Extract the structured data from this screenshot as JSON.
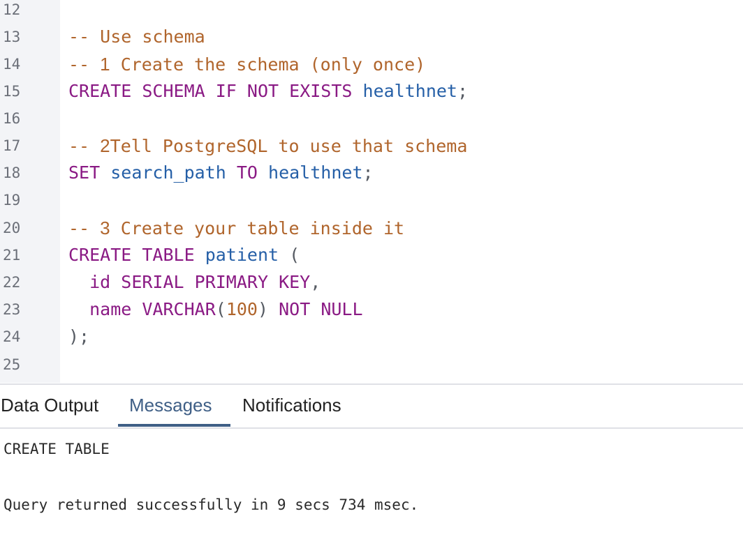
{
  "editor": {
    "line_numbers": [
      "12",
      "13",
      "14",
      "15",
      "16",
      "17",
      "18",
      "19",
      "20",
      "21",
      "22",
      "23",
      "24",
      "25"
    ],
    "lines": {
      "l13": {
        "comment": "-- Use schema"
      },
      "l14": {
        "dash": "--",
        "num": "1",
        "rest": "Create the schema (only once)"
      },
      "l15": {
        "kw1": "CREATE",
        "kw2": "SCHEMA",
        "kw3": "IF",
        "kw4": "NOT",
        "kw5": "EXISTS",
        "ident": "healthnet",
        "end": ";"
      },
      "l17": {
        "dash": "--",
        "num": "2",
        "rest": "Tell PostgreSQL to use that schema"
      },
      "l18": {
        "kw1": "SET",
        "ident1": "search_path",
        "kw2": "TO",
        "ident2": "healthnet",
        "end": ";"
      },
      "l20": {
        "dash": "--",
        "num": "3",
        "rest": "Create your table inside it"
      },
      "l21": {
        "kw1": "CREATE",
        "kw2": "TABLE",
        "ident": "patient",
        "paren": "("
      },
      "l22": {
        "col": "id",
        "type": "SERIAL",
        "kw1": "PRIMARY",
        "kw2": "KEY",
        "comma": ","
      },
      "l23": {
        "col": "name",
        "type": "VARCHAR",
        "po": "(",
        "num": "100",
        "pc": ")",
        "kw1": "NOT",
        "kw2": "NULL"
      },
      "l24": {
        "close": ");"
      }
    }
  },
  "tabs": {
    "data_output": "Data Output",
    "messages": "Messages",
    "notifications": "Notifications",
    "active": "Messages"
  },
  "messages": {
    "line1": "CREATE TABLE",
    "line2": "Query returned successfully in 9 secs 734 msec."
  },
  "colors": {
    "keyword": "#8a1a84",
    "identifier": "#255fa7",
    "comment": "#b0652c",
    "active_tab": "#3f5f86"
  }
}
